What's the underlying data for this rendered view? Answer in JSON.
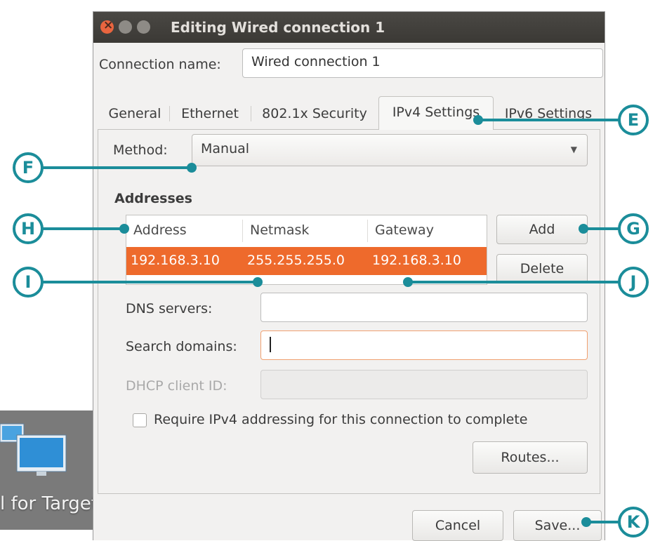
{
  "window": {
    "title": "Editing Wired connection 1"
  },
  "connection": {
    "label": "Connection name:",
    "value": "Wired connection 1"
  },
  "tabs": [
    {
      "label": "General"
    },
    {
      "label": "Ethernet"
    },
    {
      "label": "802.1x Security"
    },
    {
      "label": "IPv4 Settings",
      "active": true
    },
    {
      "label": "IPv6 Settings"
    }
  ],
  "ipv4": {
    "method_label": "Method:",
    "method_value": "Manual",
    "addresses_heading": "Addresses",
    "columns": [
      "Address",
      "Netmask",
      "Gateway"
    ],
    "rows": [
      {
        "address": "192.168.3.10",
        "netmask": "255.255.255.0",
        "gateway": "192.168.3.10"
      }
    ],
    "add_label": "Add",
    "delete_label": "Delete",
    "dns_label": "DNS servers:",
    "dns_value": "",
    "search_label": "Search domains:",
    "search_value": "",
    "dhcp_label": "DHCP client ID:",
    "dhcp_value": "",
    "require_label": "Require IPv4 addressing for this connection to complete",
    "require_checked": false,
    "routes_label": "Routes..."
  },
  "footer": {
    "cancel_label": "Cancel",
    "save_label": "Save..."
  },
  "desktop": {
    "icon_name": "network-computers-icon",
    "label": "l for Target"
  },
  "callouts": [
    {
      "letter": "E"
    },
    {
      "letter": "F"
    },
    {
      "letter": "G"
    },
    {
      "letter": "H"
    },
    {
      "letter": "I"
    },
    {
      "letter": "J"
    },
    {
      "letter": "K"
    }
  ],
  "colors": {
    "selection": "#ee6a2c",
    "callout": "#1b8d9a",
    "titlebar": "#3f3d39"
  }
}
